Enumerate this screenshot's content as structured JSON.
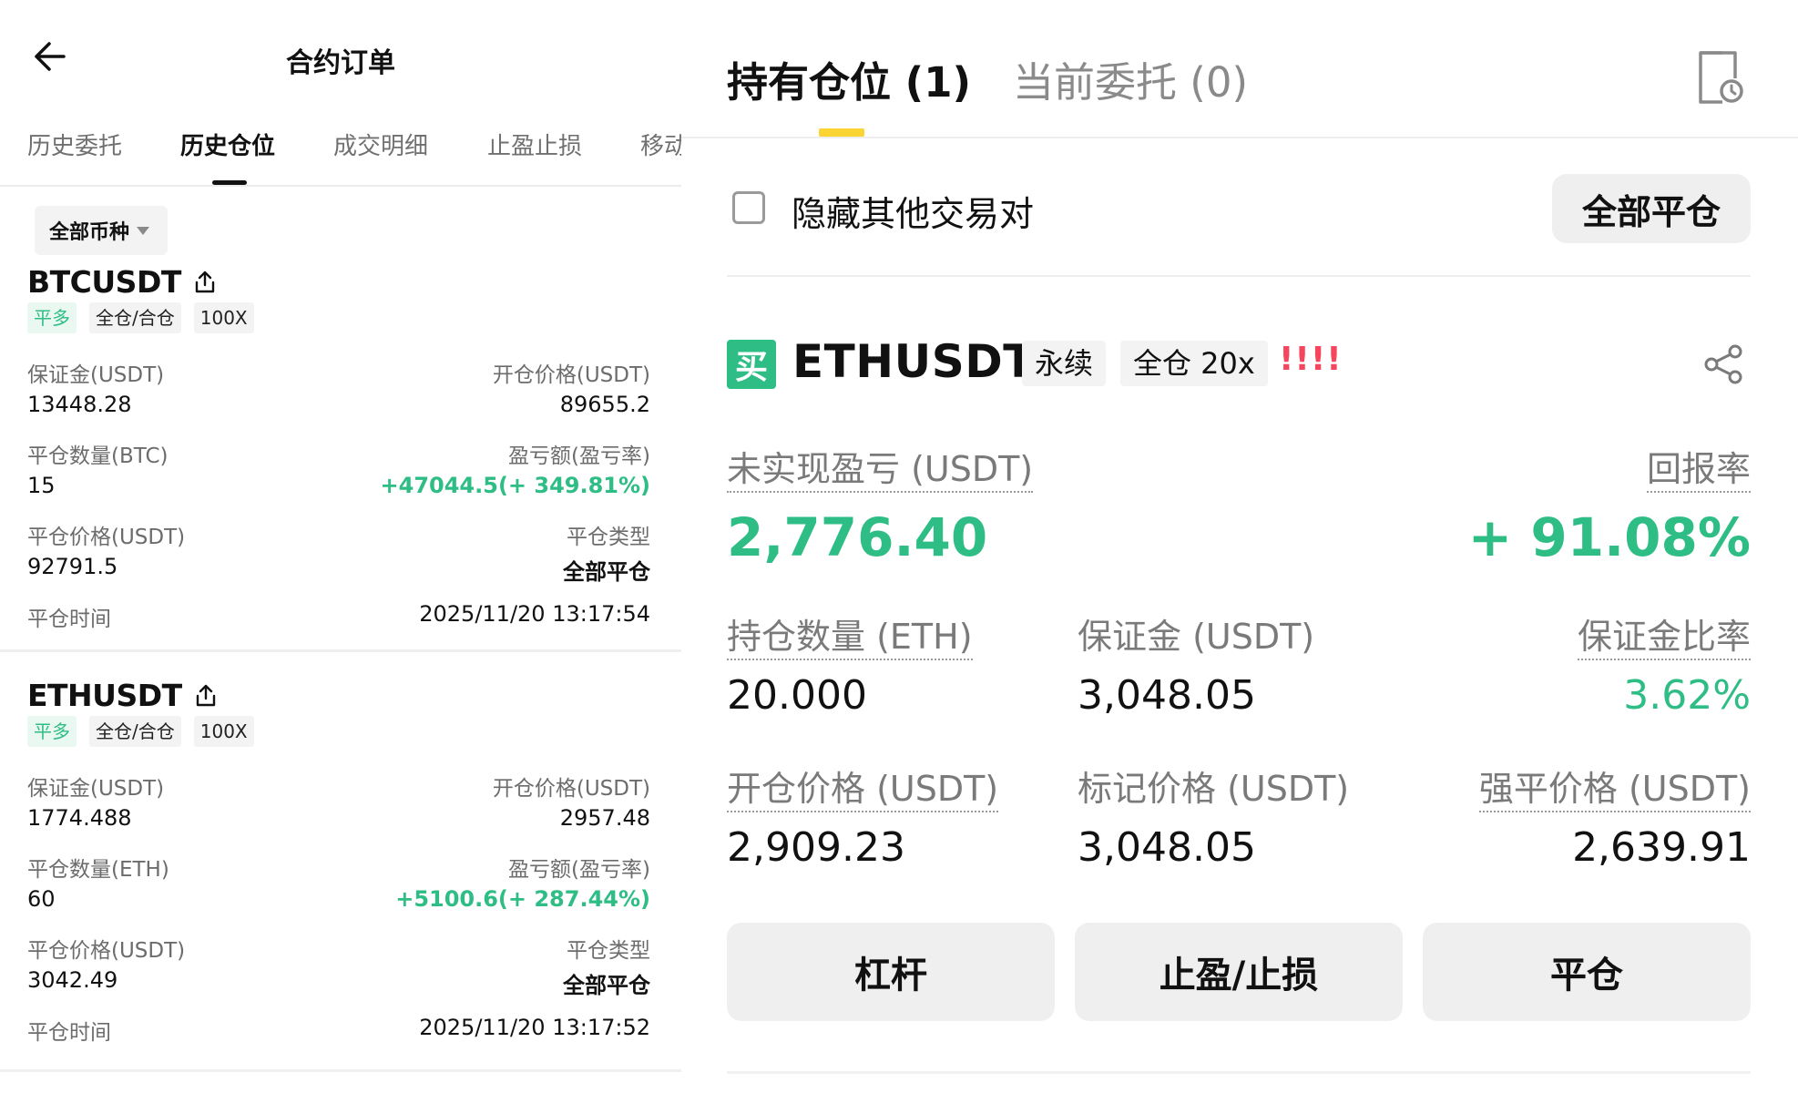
{
  "left": {
    "title": "合约订单",
    "tabs": [
      "历史委托",
      "历史仓位",
      "成交明细",
      "止盈止损",
      "移动"
    ],
    "active_tab": "历史仓位",
    "coin_filter": "全部币种",
    "positions": [
      {
        "symbol": "BTCUSDT",
        "tags": [
          "平多",
          "全仓/合仓",
          "100X"
        ],
        "margin_label": "保证金(USDT)",
        "margin": "13448.28",
        "open_price_label": "开仓价格(USDT)",
        "open_price": "89655.2",
        "close_qty_label": "平仓数量(BTC)",
        "close_qty": "15",
        "pnl_label": "盈亏额(盈亏率)",
        "pnl": "+47044.5(+ 349.81%)",
        "close_price_label": "平仓价格(USDT)",
        "close_price": "92791.5",
        "close_type_label": "平仓类型",
        "close_type": "全部平仓",
        "close_time_label": "平仓时间",
        "close_time": "2025/11/20 13:17:54"
      },
      {
        "symbol": "ETHUSDT",
        "tags": [
          "平多",
          "全仓/合仓",
          "100X"
        ],
        "margin_label": "保证金(USDT)",
        "margin": "1774.488",
        "open_price_label": "开仓价格(USDT)",
        "open_price": "2957.48",
        "close_qty_label": "平仓数量(ETH)",
        "close_qty": "60",
        "pnl_label": "盈亏额(盈亏率)",
        "pnl": "+5100.6(+ 287.44%)",
        "close_price_label": "平仓价格(USDT)",
        "close_price": "3042.49",
        "close_type_label": "平仓类型",
        "close_type": "全部平仓",
        "close_time_label": "平仓时间",
        "close_time": "2025/11/20 13:17:52"
      }
    ]
  },
  "right": {
    "tabs": [
      "持有仓位 (1)",
      "当前委托 (0)"
    ],
    "hide_pairs_label": "隐藏其他交易对",
    "close_all_label": "全部平仓",
    "position": {
      "side_badge": "买",
      "symbol": "ETHUSDT",
      "contract_type": "永续",
      "margin_mode": "全仓 20x",
      "warning": "!!!!",
      "unrealized_pnl_label": "未实现盈亏 (USDT)",
      "unrealized_pnl": "2,776.40",
      "roe_label": "回报率",
      "roe": "+ 91.08%",
      "size_label": "持仓数量 (ETH)",
      "size": "20.000",
      "margin_label": "保证金 (USDT)",
      "margin": "3,048.05",
      "margin_ratio_label": "保证金比率",
      "margin_ratio": "3.62%",
      "entry_price_label": "开仓价格 (USDT)",
      "entry_price": "2,909.23",
      "mark_price_label": "标记价格 (USDT)",
      "mark_price": "3,048.05",
      "liq_price_label": "强平价格 (USDT)",
      "liq_price": "2,639.91"
    },
    "actions": [
      "杠杆",
      "止盈/止损",
      "平仓"
    ]
  },
  "colors": {
    "green": "#2ebd85",
    "red": "#f6465d",
    "accent_yellow": "#fcd535"
  },
  "icons": [
    "back-arrow-icon",
    "share-icon",
    "order-history-icon",
    "share-nodes-icon"
  ]
}
